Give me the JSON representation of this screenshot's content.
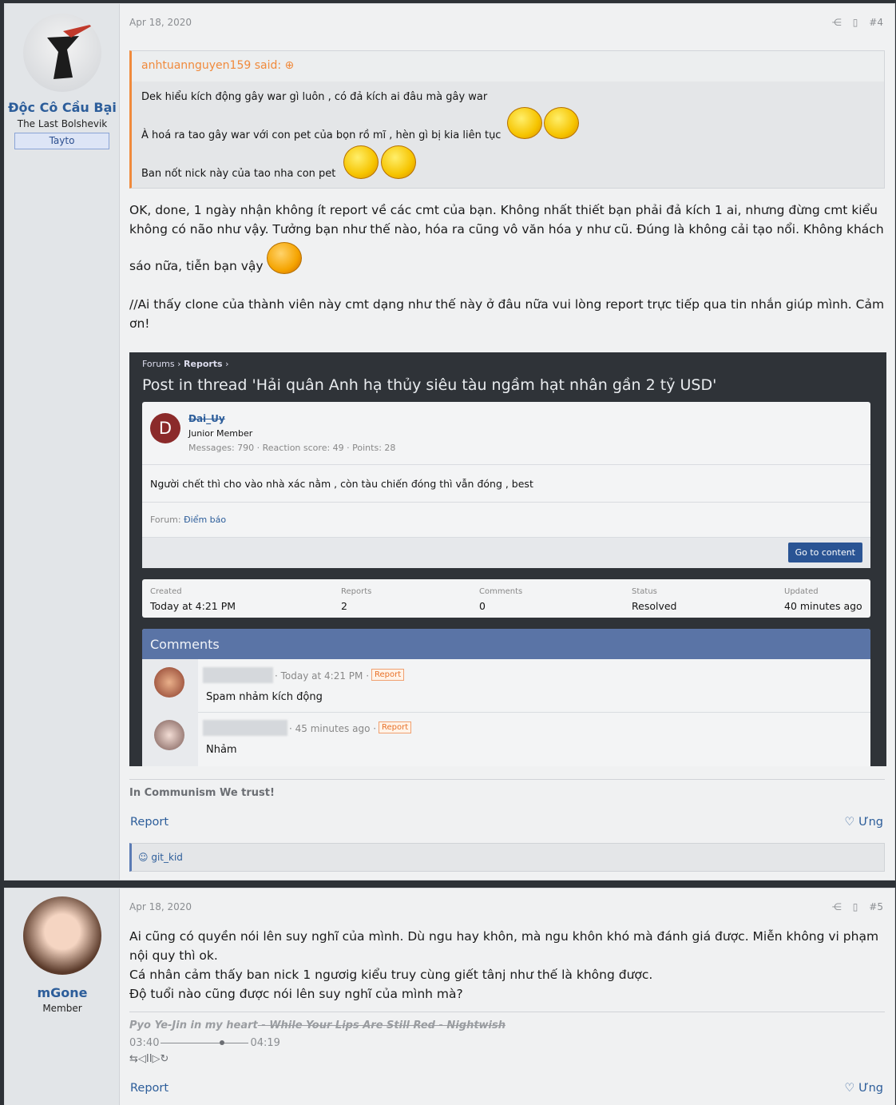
{
  "post4": {
    "user": {
      "name": "Độc Cô Cầu Bại",
      "title": "The Last Bolshevik",
      "banner": "Tayto"
    },
    "date": "Apr 18, 2020",
    "number": "#4",
    "quote": {
      "author": "anhtuannguyen159 said:",
      "lines": [
        "Dek hiểu kích động gây war gì luôn , có đả kích ai đâu mà gây war",
        "À hoá ra tao gây war với con pet của bọn rồ mĩ , hèn gì bị kia liên tục",
        "Ban nốt nick này của tao nha con pet"
      ]
    },
    "body": [
      "OK, done, 1 ngày nhận không ít report về các cmt của bạn. Không nhất thiết bạn phải đả kích 1 ai, nhưng đừng cmt kiểu không có não như vậy. Tưởng bạn như thế nào, hóa ra cũng vô văn hóa y như cũ. Đúng là không cải tạo nổi. Không khách",
      "sáo nữa, tiễn bạn vậy",
      "//Ai thấy clone của thành viên này cmt dạng như thế này ở đâu nữa vui lòng report trực tiếp qua tin nhắn giúp mình. Cảm ơn!"
    ],
    "screenshot": {
      "breadcrumb1": "Forums",
      "breadcrumb2": "Reports",
      "title": "Post in thread 'Hải quân Anh hạ thủy siêu tàu ngầm hạt nhân gần 2 tỷ USD'",
      "avatar_letter": "D",
      "poster": "Dai_Uy",
      "poster_role": "Junior Member",
      "poster_stats": "Messages: 790 · Reaction score: 49 · Points: 28",
      "content": "Người chết thì cho vào nhà xác nằm , còn tàu chiến đóng thì vẫn đóng , best",
      "forum_label": "Forum:",
      "forum_name": "Điểm báo",
      "go_button": "Go to content",
      "stats": [
        {
          "label": "Created",
          "value": "Today at 4:21 PM"
        },
        {
          "label": "Reports",
          "value": "2"
        },
        {
          "label": "Comments",
          "value": "0"
        },
        {
          "label": "Status",
          "value": "Resolved"
        },
        {
          "label": "Updated",
          "value": "40 minutes ago"
        }
      ],
      "comments_title": "Comments",
      "comments": [
        {
          "time": "· Today at 4:21 PM ·",
          "tag": "Report",
          "text": "Spam nhảm kích động"
        },
        {
          "time": "· 45 minutes ago ·",
          "tag": "Report",
          "text": "Nhảm"
        }
      ]
    },
    "signature": "In Communism We trust!",
    "report": "Report",
    "reply": "Ưng",
    "reaction_user": "git_kid"
  },
  "post5": {
    "user": {
      "name": "mGone",
      "title": "Member"
    },
    "date": "Apr 18, 2020",
    "number": "#5",
    "body": [
      "Ai cũng có quyền nói lên suy nghĩ của mình. Dù ngu hay khôn, mà ngu khôn khó mà đánh giá được. Miễn không vi phạm nội quy thì ok.",
      "Cá nhân cảm thấy ban nick 1 ngươig kiểu truy cùng giết tânj như thế là không được.",
      "Độ tuổi nào cũng được nói lên suy nghĩ của mình mà?"
    ],
    "sig_song": "Pyo Ye-Jin in my heart",
    "sig_track": " - While Your Lips Are Still Red - Nightwish",
    "time_start": "03:40",
    "time_end": "04:19",
    "player": "⇆◁II▷↻",
    "report": "Report",
    "reply": "Ưng"
  }
}
